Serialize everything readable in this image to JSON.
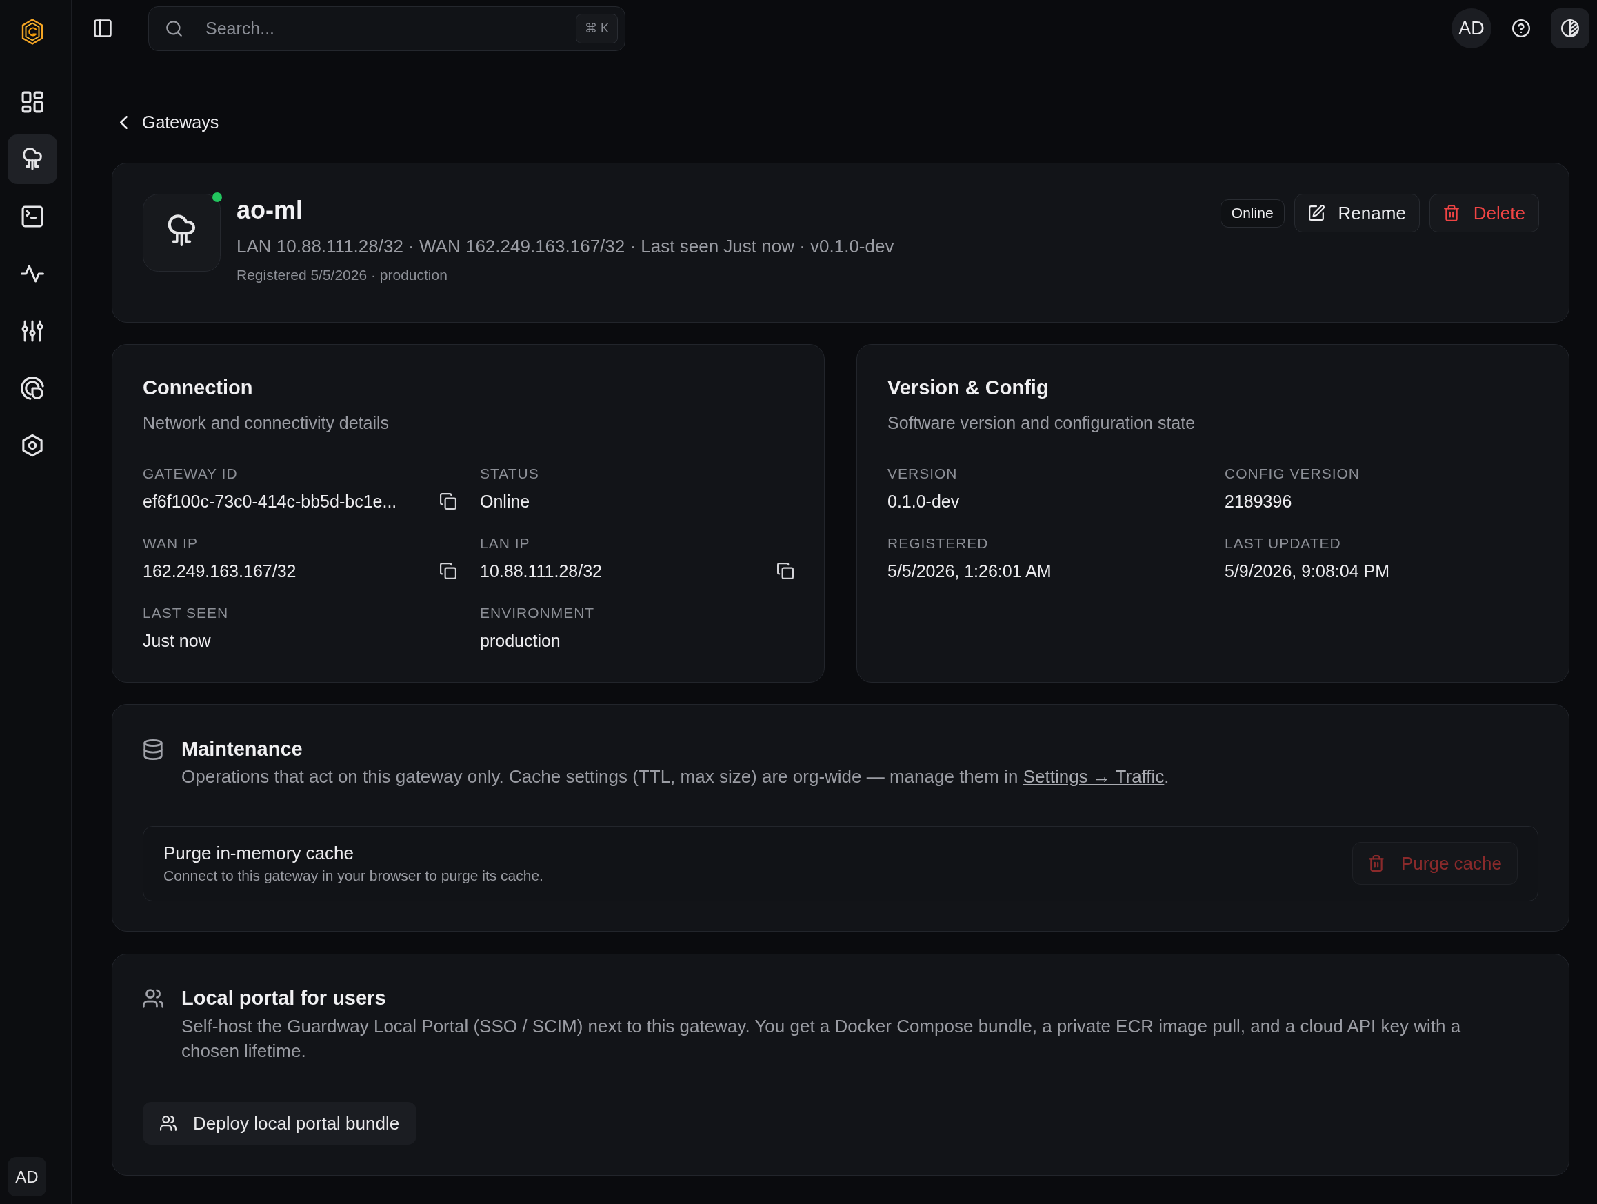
{
  "sidebar": {
    "items": [
      {
        "selected": false
      },
      {
        "selected": true
      },
      {
        "selected": false
      },
      {
        "selected": false
      },
      {
        "selected": false
      },
      {
        "selected": false
      },
      {
        "selected": false
      }
    ],
    "user_initials": "AD"
  },
  "top_bar": {
    "search": {
      "placeholder": "Search...",
      "shortcut": "⌘ K"
    },
    "user_initials": "AD"
  },
  "breadcrumb": {
    "back_label": "Gateways"
  },
  "gateway": {
    "name": "ao-ml",
    "online": true,
    "summary": "LAN 10.88.111.28/32 · WAN 162.249.163.167/32 · Last seen Just now · v0.1.0-dev",
    "meta": "Registered 5/5/2026 · production",
    "status_badge": "Online",
    "actions": [
      {
        "label": "Rename",
        "kind": "edit"
      },
      {
        "label": "Delete",
        "kind": "delete"
      }
    ]
  },
  "detail_cards": [
    {
      "title": "Connection",
      "subtitle": "Network and connectivity details",
      "fields": [
        {
          "label": "GATEWAY ID",
          "value": "ef6f100c-73c0-414c-bb5d-bc1e...",
          "copyable": true
        },
        {
          "label": "STATUS",
          "value": "Online",
          "copyable": false
        },
        {
          "label": "WAN IP",
          "value": "162.249.163.167/32",
          "copyable": true
        },
        {
          "label": "LAN IP",
          "value": "10.88.111.28/32",
          "copyable": true
        },
        {
          "label": "LAST SEEN",
          "value": "Just now",
          "copyable": false
        },
        {
          "label": "ENVIRONMENT",
          "value": "production",
          "copyable": false
        }
      ]
    },
    {
      "title": "Version & Config",
      "subtitle": "Software version and configuration state",
      "fields": [
        {
          "label": "VERSION",
          "value": "0.1.0-dev"
        },
        {
          "label": "CONFIG VERSION",
          "value": "2189396"
        },
        {
          "label": "REGISTERED",
          "value": "5/5/2026, 1:26:01 AM"
        },
        {
          "label": "LAST UPDATED",
          "value": "5/9/2026, 9:08:04 PM"
        }
      ]
    }
  ],
  "maintenance": {
    "title": "Maintenance",
    "description": [
      {
        "kind": "text",
        "text": "Operations that act on this gateway only. Cache settings (TTL, max size) are org-wide — manage them in "
      },
      {
        "kind": "link",
        "text": "Settings → Traffic"
      },
      {
        "kind": "text",
        "text": "."
      }
    ],
    "actions": [
      {
        "title": "Purge in-memory cache",
        "description": "Connect to this gateway in your browser to purge its cache.",
        "button": {
          "label": "Purge cache",
          "disabled": true
        }
      }
    ]
  },
  "local_portal": {
    "title": "Local portal for users",
    "description": "Self-host the Guardway Local Portal (SSO / SCIM) next to this gateway. You get a Docker Compose bundle, a private ECR image pull, and a cloud API key with a chosen lifetime.",
    "button": {
      "label": "Deploy local portal bundle"
    }
  }
}
